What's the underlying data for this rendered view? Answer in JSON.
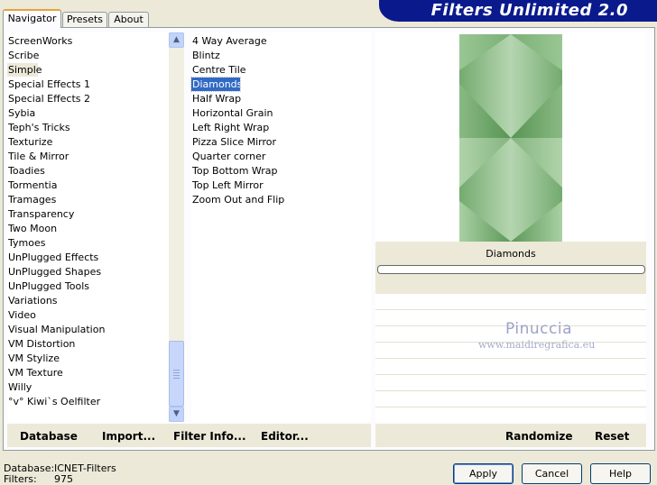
{
  "title": "Filters Unlimited 2.0",
  "tabs": [
    "Navigator",
    "Presets",
    "About"
  ],
  "categories": [
    "ScreenWorks",
    "Scribe",
    "Simple",
    "Special Effects 1",
    "Special Effects 2",
    "Sybia",
    "Teph's Tricks",
    "Texturize",
    "Tile & Mirror",
    "Toadies",
    "Tormentia",
    "Tramages",
    "Transparency",
    "Two Moon",
    "Tymoes",
    "UnPlugged Effects",
    "UnPlugged Shapes",
    "UnPlugged Tools",
    "Variations",
    "Video",
    "Visual Manipulation",
    "VM Distortion",
    "VM Stylize",
    "VM Texture",
    "Willy",
    "°v° Kiwi`s Oelfilter"
  ],
  "selected_category": "Simple",
  "filters": [
    "4 Way Average",
    "Blintz",
    "Centre Tile",
    "Diamonds",
    "Half Wrap",
    "Horizontal Grain",
    "Left Right Wrap",
    "Pizza Slice Mirror",
    "Quarter corner",
    "Top Bottom Wrap",
    "Top Left Mirror",
    "Zoom Out and Flip"
  ],
  "selected_filter": "Diamonds",
  "scroll_icons": {
    "up": "chevron-up-icon",
    "down": "chevron-down-icon"
  },
  "left_buttons": {
    "database": "Database",
    "import": "Import...",
    "filter_info": "Filter Info...",
    "editor": "Editor..."
  },
  "preview_caption": "Diamonds",
  "right_buttons": {
    "randomize": "Randomize",
    "reset": "Reset"
  },
  "watermark": {
    "name": "Pinuccia",
    "url": "www.maidiregrafica.eu"
  },
  "status": {
    "database_label": "Database:",
    "database_value": "ICNET-Filters",
    "filters_label": "Filters:",
    "filters_value": "975"
  },
  "dialog_buttons": {
    "apply": "Apply",
    "cancel": "Cancel",
    "help": "Help"
  },
  "colors": {
    "banner": "#0a1a8c",
    "selection": "#316ac5",
    "preview_green": "#7fb07a"
  }
}
